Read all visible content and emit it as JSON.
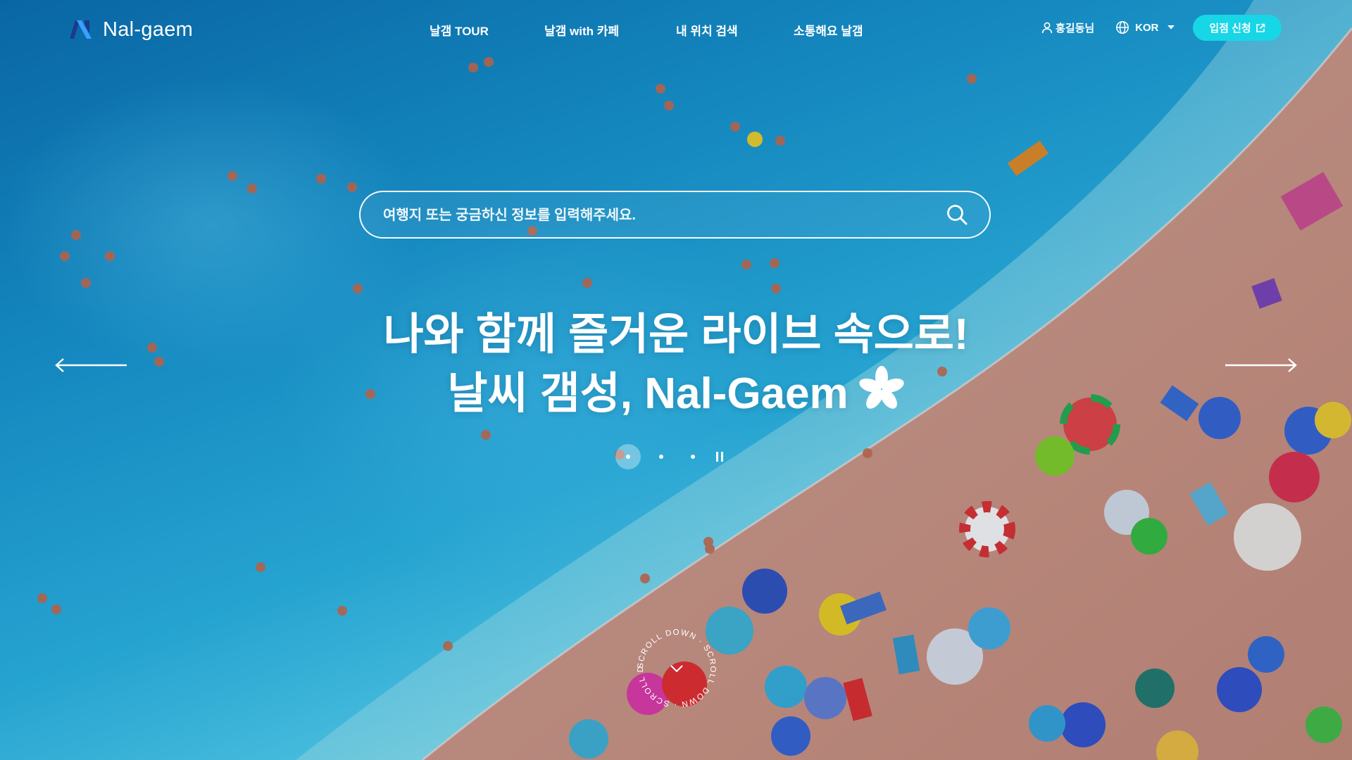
{
  "brand": {
    "name": "Nal-gaem"
  },
  "nav": {
    "items": [
      {
        "label": "날갬 TOUR"
      },
      {
        "label": "날갬 with 카페"
      },
      {
        "label": "내 위치 검색"
      },
      {
        "label": "소통해요 날갬"
      }
    ]
  },
  "header": {
    "user_label": "홍길동님",
    "language": "KOR",
    "apply_label": "입점 신청"
  },
  "search": {
    "placeholder": "여행지 또는 궁금하신 정보를 입력해주세요."
  },
  "hero": {
    "line1": "나와 함께 즐거운 라이브 속으로!",
    "line2": "날씨 갬성, Nal-Gaem"
  },
  "carousel": {
    "slide_count": 3,
    "active_index": 0
  },
  "scroll_badge": {
    "text": "SCROLL DOWN · SCROLL DOWN · SCROLL DOWN · "
  },
  "colors": {
    "accent": "#17d6e6",
    "logo_dark": "#1a3a8a",
    "logo_light": "#3aa0ff"
  },
  "icons": [
    "logo-icon",
    "user-icon",
    "globe-icon",
    "caret-down-icon",
    "external-link-icon",
    "search-icon",
    "arrow-left-icon",
    "arrow-right-icon",
    "pause-icon",
    "flower-icon",
    "chevron-down-icon"
  ]
}
